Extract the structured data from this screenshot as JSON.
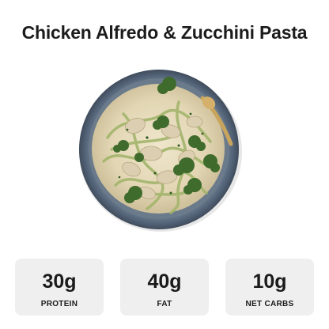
{
  "recipe": {
    "title": "Chicken Alfredo & Zucchini Pasta"
  },
  "image": {
    "icon": "pasta-bowl-photo"
  },
  "macros": [
    {
      "value": "30g",
      "label": "PROTEIN"
    },
    {
      "value": "40g",
      "label": "FAT"
    },
    {
      "value": "10g",
      "label": "NET CARBS"
    }
  ],
  "colors": {
    "card_bg": "#efefef",
    "text": "#1a1a1a",
    "plate": "#5f6f80",
    "sauce": "#e6dcc0",
    "broccoli": "#3f6b2c"
  }
}
